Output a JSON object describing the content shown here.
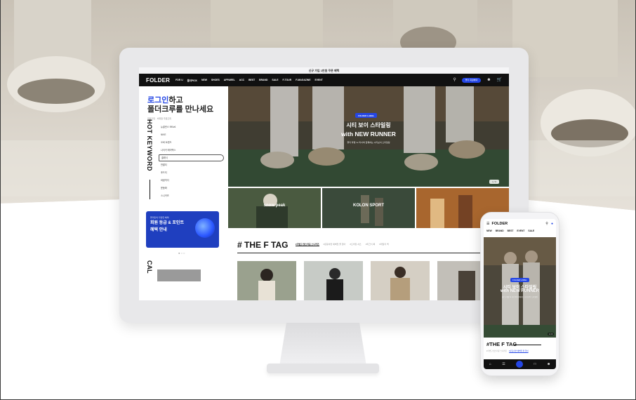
{
  "promo_bar": {
    "text": "신규 가입 1만원 쿠폰 혜택"
  },
  "site": {
    "logo": "FOLDER",
    "menu": [
      "FOR U",
      "폴더PICK",
      "NEW",
      "SHOES",
      "APPAREL",
      "ACC",
      "BEST",
      "BRAND",
      "SALE",
      "F-TOUR",
      "F-MAGAZINE",
      "EVENT"
    ],
    "member_pill": "폴더 회원혜택"
  },
  "left": {
    "hello_blue": "로그인",
    "hello_rest": "하고",
    "hello_line2": "폴더크루를 만나세요",
    "sub": "회원가입 · 비회원 주문조회",
    "hot_keyword_title": "HOT KEYWORD",
    "keywords": [
      "뉴발란스 990v6",
      "NIKE",
      "오버 트렌드",
      "나이키 에어맥스",
      "클래식",
      "반팔티",
      "후드티",
      "바람막이",
      "운동화",
      "스니커즈"
    ],
    "selected_keyword_index": 4,
    "banner_small": "폴더만의 다양한 혜택",
    "banner_line1": "회원 등급 & 포인트",
    "banner_line2": "혜택 안내",
    "cal_title": "CAL"
  },
  "hero": {
    "tag": "FOLDER LABEL",
    "title1": "시티 보이 스타일링",
    "title2": "with NEW RUNNER",
    "sub": "폴더 라벨 'to 러너'와 함께하는 시티보이 스타일링",
    "pager": "1 / 6"
  },
  "brands": [
    {
      "label": "snow peak"
    },
    {
      "label": "KOLON SPORT"
    },
    {
      "label": ""
    }
  ],
  "ftag": {
    "title": "# THE F TAG",
    "tabs": [
      "#가볍고 멋스러운 스니커즈",
      "#운동하면 예뻐질 줄 알아",
      "#오버핏 셔츠",
      "#피크닉 룩",
      "#데일리 백"
    ]
  },
  "phone": {
    "logo": "FOLDER",
    "nav": [
      "NEW",
      "BRAND",
      "BEST",
      "EVENT",
      "SALE"
    ],
    "hero_tag": "FOLDER LABEL",
    "hero_title1": "시티 보이 스타일링",
    "hero_title2": "with NEW RUNNER",
    "hero_sub": "폴더 라벨 'to 러너'와 함께하는 시티보이 스타일링",
    "hero_pager": "1 / 6",
    "ftag_hash": "#",
    "ftag_f": "THE F",
    "ftag_tag": "TAG",
    "ftag_tabs": [
      "#가볍고 멋스러운 스니커즈",
      "#운동하면 예뻐질 줄 알아"
    ]
  },
  "colors": {
    "accent": "#2446e5",
    "gnb": "#111111",
    "monitor": "#e8e8ea"
  }
}
